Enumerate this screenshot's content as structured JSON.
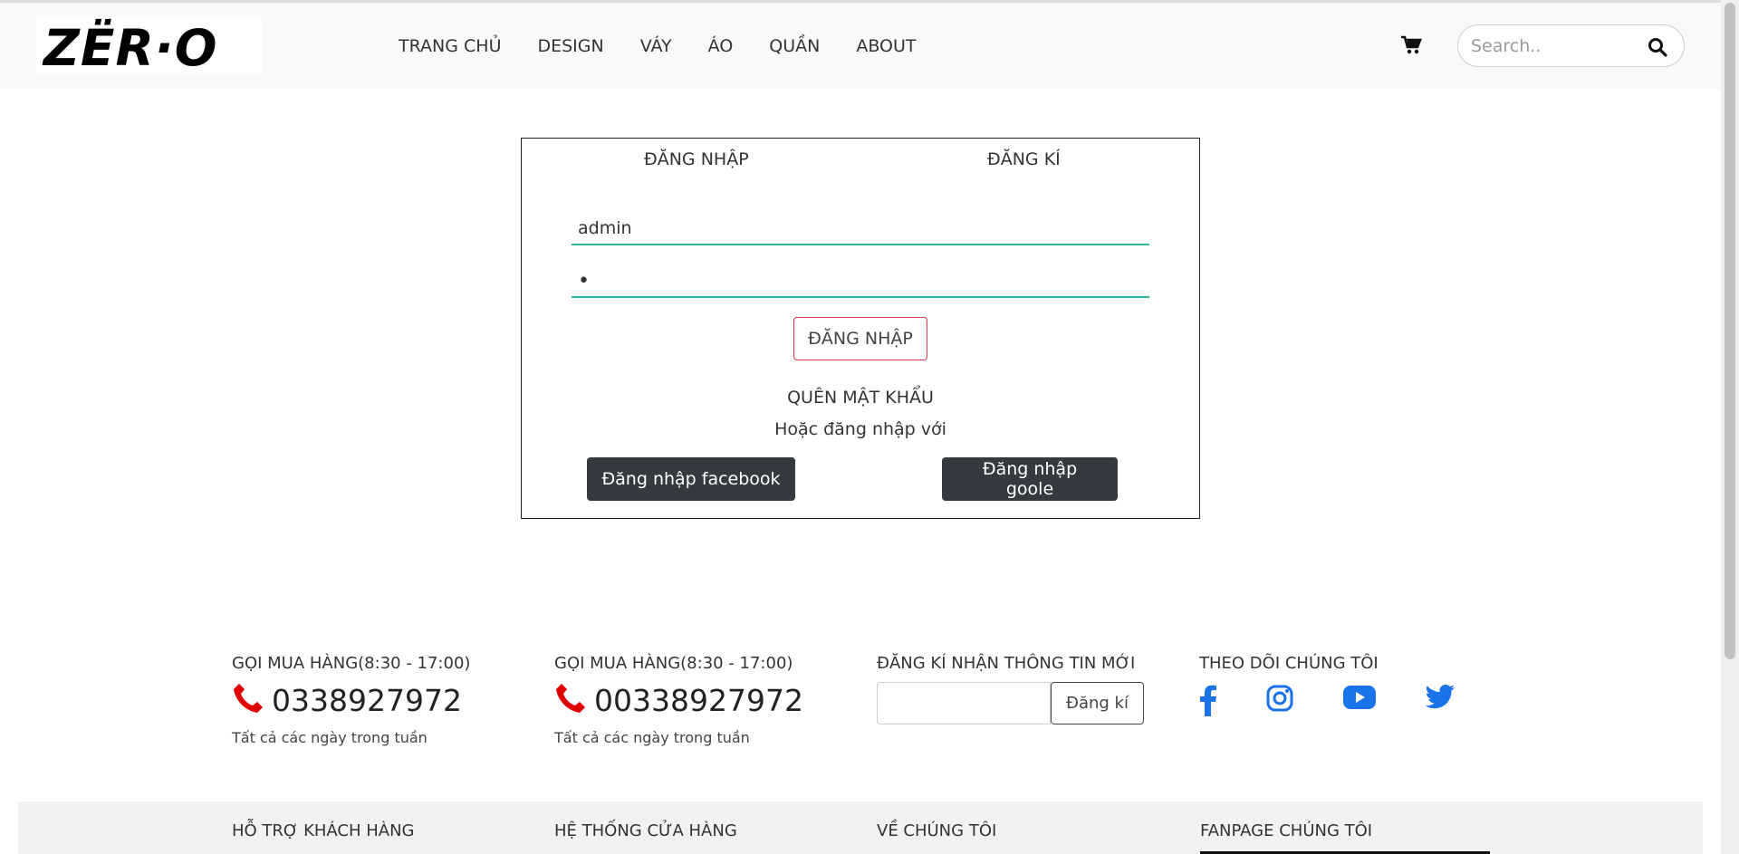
{
  "brand": {
    "logo_text": "ZËR·O"
  },
  "nav": {
    "items": [
      "TRANG CHỦ",
      "DESIGN",
      "VÁY",
      "ÁO",
      "QUẦN",
      "ABOUT"
    ]
  },
  "search": {
    "placeholder": "Search.."
  },
  "login": {
    "tab_login": "ĐĂNG NHẬP",
    "tab_register": "ĐĂNG KÍ",
    "username_value": "admin",
    "password_value": "•",
    "submit_label": "ĐĂNG NHẬP",
    "forgot_label": "QUÊN MẬT KHẨU",
    "or_label": "Hoặc đăng nhập với",
    "facebook_label": "Đăng nhập facebook",
    "google_label": "Đăng nhập goole"
  },
  "footer": {
    "call1": {
      "title": "GỌI MUA HÀNG(8:30 - 17:00)",
      "number": "0338927972",
      "sub": "Tất cả các ngày trong tuần"
    },
    "call2": {
      "title": "GỌI MUA HÀNG(8:30 - 17:00)",
      "number": "00338927972",
      "sub": "Tất cả các ngày trong tuần"
    },
    "newsletter": {
      "title": "ĐĂNG KÍ NHẬN THÔNG TIN MỚI",
      "button": "Đăng kí"
    },
    "follow": {
      "title": "THEO DÕI CHÚNG TÔI"
    },
    "bottom": [
      "HỖ TRỢ KHÁCH HÀNG",
      "HỆ THỐNG CỬA HÀNG",
      "VỀ CHÚNG TÔI",
      "FANPAGE CHÚNG TÔI"
    ]
  },
  "colors": {
    "accent_teal": "#2fb5a0",
    "phone_red": "#e00000",
    "social_blue": "#1a73e8",
    "dark_button": "#343a40"
  },
  "icons": [
    "cart-icon",
    "search-icon",
    "phone-icon",
    "facebook-icon",
    "instagram-icon",
    "youtube-icon",
    "twitter-icon"
  ]
}
